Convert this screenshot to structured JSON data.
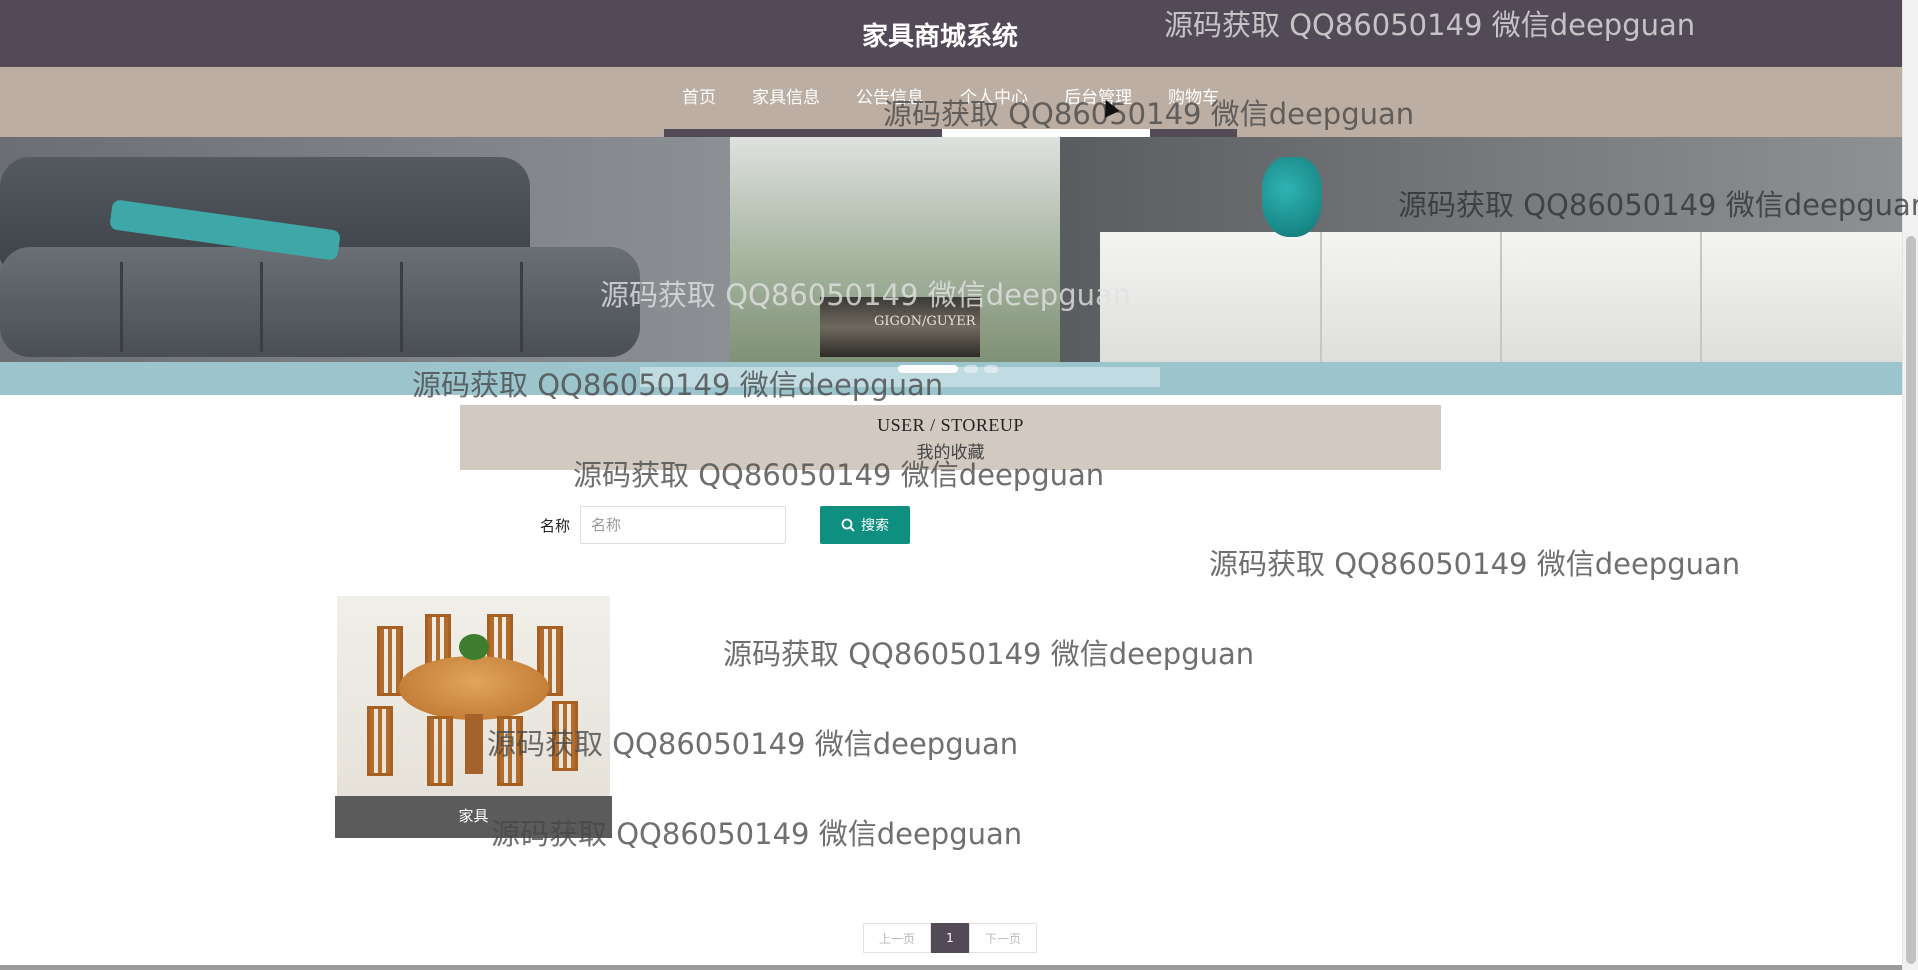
{
  "site": {
    "title": "家具商城系统"
  },
  "nav": {
    "items": [
      {
        "label": "首页"
      },
      {
        "label": "家具信息"
      },
      {
        "label": "公告信息"
      },
      {
        "label": "个人中心"
      },
      {
        "label": "后台管理"
      },
      {
        "label": "购物车"
      }
    ]
  },
  "banner": {
    "books_text": "GIGON/GUYER",
    "slides": 3,
    "active_slide": 1
  },
  "section": {
    "en_title": "USER / STOREUP",
    "cn_title": "我的收藏"
  },
  "search": {
    "label": "名称",
    "placeholder": "名称",
    "value": "",
    "button_label": "搜索",
    "button_icon": "search-icon"
  },
  "products": [
    {
      "caption": "家具"
    }
  ],
  "pagination": {
    "prev_label": "上一页",
    "current_page": "1",
    "next_label": "下一页"
  },
  "watermark": {
    "text": "源码获取 QQ86050149 微信deepguan"
  },
  "colors": {
    "header_bg": "#534a57",
    "nav_bg": "#bcaea3",
    "section_bg": "#d2cac1",
    "search_button": "#0e8f80",
    "caption_bg": "#5b5b5b"
  }
}
